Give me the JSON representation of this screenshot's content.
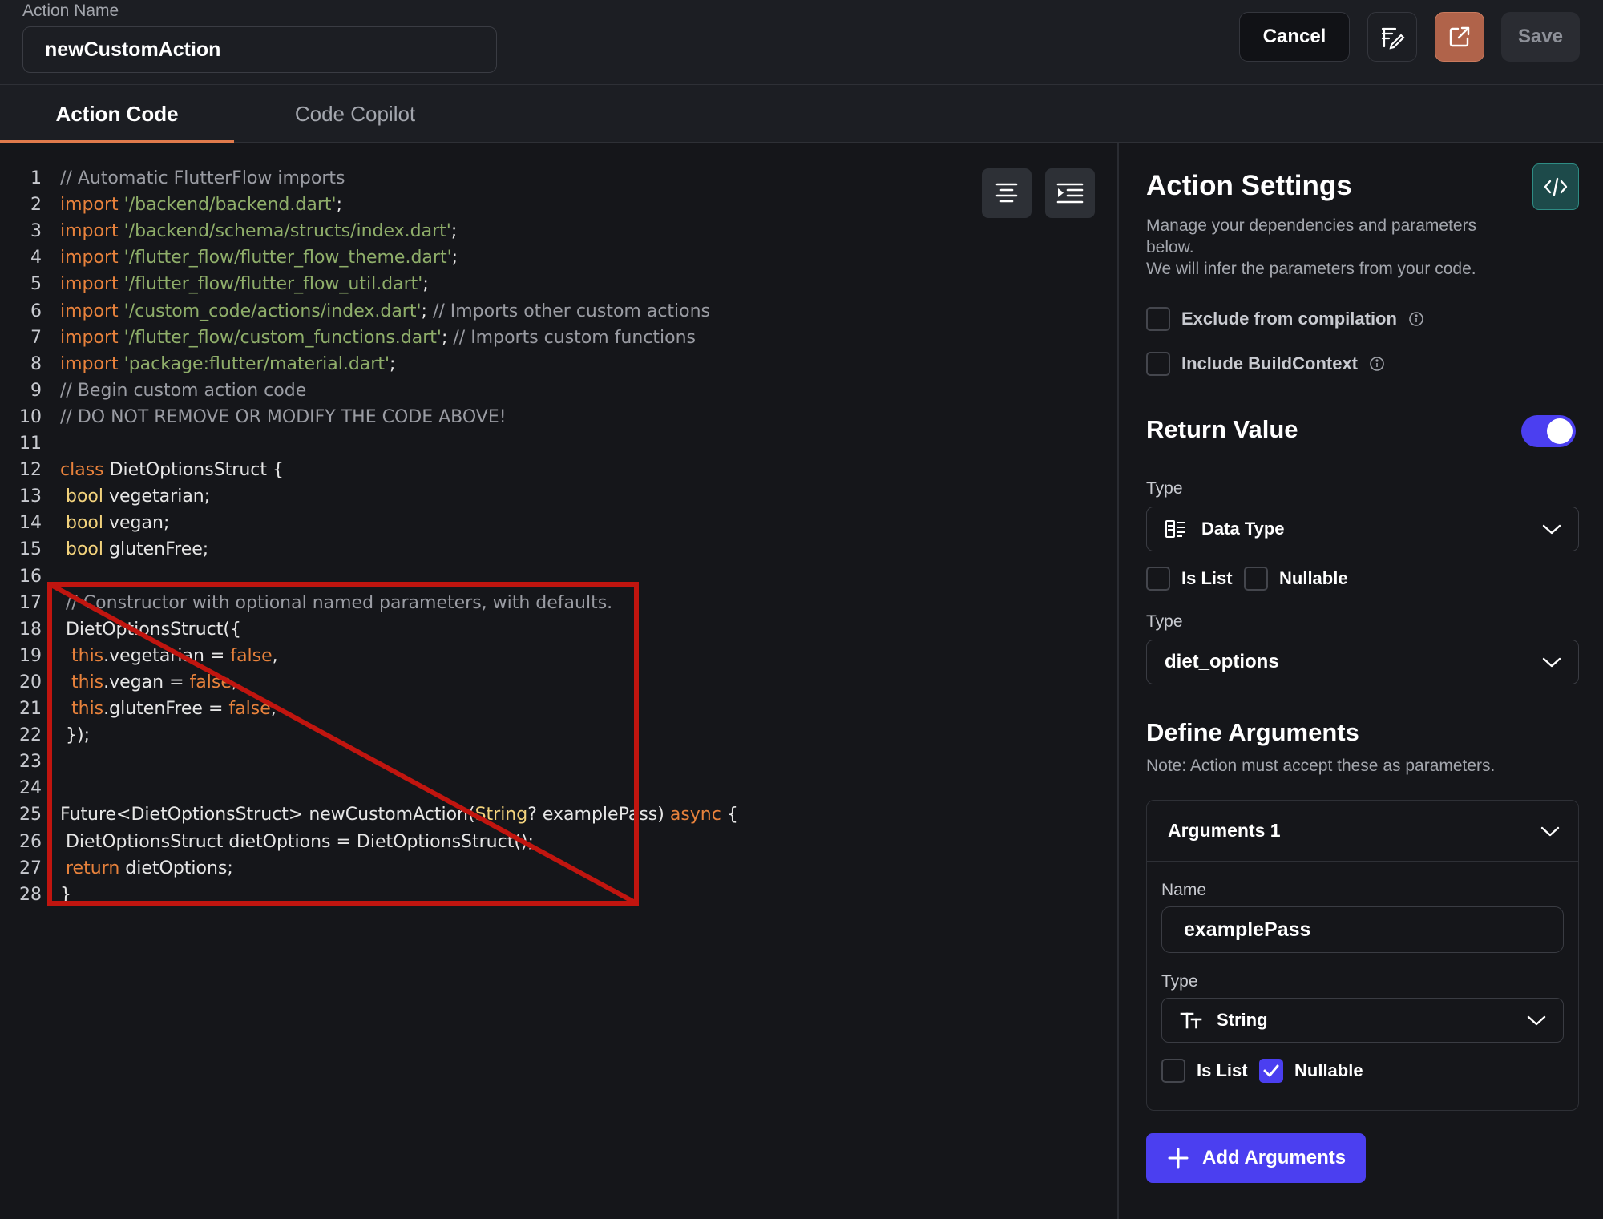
{
  "header": {
    "action_name_label": "Action Name",
    "action_name_value": "newCustomAction",
    "cancel_label": "Cancel",
    "save_label": "Save"
  },
  "tabs": [
    {
      "label": "Action Code",
      "active": true
    },
    {
      "label": "Code Copilot",
      "active": false
    }
  ],
  "code_lines": [
    {
      "n": "1",
      "tokens": [
        {
          "t": "// Automatic FlutterFlow imports",
          "c": "comment"
        }
      ]
    },
    {
      "n": "2",
      "tokens": [
        {
          "t": "import ",
          "c": "kw"
        },
        {
          "t": "'/backend/backend.dart'",
          "c": "str"
        },
        {
          "t": ";",
          "c": "plain"
        }
      ]
    },
    {
      "n": "3",
      "tokens": [
        {
          "t": "import ",
          "c": "kw"
        },
        {
          "t": "'/backend/schema/structs/index.dart'",
          "c": "str"
        },
        {
          "t": ";",
          "c": "plain"
        }
      ]
    },
    {
      "n": "4",
      "tokens": [
        {
          "t": "import ",
          "c": "kw"
        },
        {
          "t": "'/flutter_flow/flutter_flow_theme.dart'",
          "c": "str"
        },
        {
          "t": ";",
          "c": "plain"
        }
      ]
    },
    {
      "n": "5",
      "tokens": [
        {
          "t": "import ",
          "c": "kw"
        },
        {
          "t": "'/flutter_flow/flutter_flow_util.dart'",
          "c": "str"
        },
        {
          "t": ";",
          "c": "plain"
        }
      ]
    },
    {
      "n": "6",
      "tokens": [
        {
          "t": "import ",
          "c": "kw"
        },
        {
          "t": "'/custom_code/actions/index.dart'",
          "c": "str"
        },
        {
          "t": "; ",
          "c": "plain"
        },
        {
          "t": "// Imports other custom actions",
          "c": "comment"
        }
      ]
    },
    {
      "n": "7",
      "tokens": [
        {
          "t": "import ",
          "c": "kw"
        },
        {
          "t": "'/flutter_flow/custom_functions.dart'",
          "c": "str"
        },
        {
          "t": "; ",
          "c": "plain"
        },
        {
          "t": "// Imports custom functions",
          "c": "comment"
        }
      ]
    },
    {
      "n": "8",
      "tokens": [
        {
          "t": "import ",
          "c": "kw"
        },
        {
          "t": "'package:flutter/material.dart'",
          "c": "str"
        },
        {
          "t": ";",
          "c": "plain"
        }
      ]
    },
    {
      "n": "9",
      "tokens": [
        {
          "t": "// Begin custom action code",
          "c": "comment"
        }
      ]
    },
    {
      "n": "10",
      "tokens": [
        {
          "t": "// DO NOT REMOVE OR MODIFY THE CODE ABOVE!",
          "c": "comment"
        }
      ]
    },
    {
      "n": "11",
      "tokens": []
    },
    {
      "n": "12",
      "tokens": [
        {
          "t": "class ",
          "c": "kw"
        },
        {
          "t": "DietOptionsStruct {",
          "c": "plain"
        }
      ]
    },
    {
      "n": "13",
      "tokens": [
        {
          "t": " ",
          "c": "plain"
        },
        {
          "t": "bool",
          "c": "type"
        },
        {
          "t": " vegetarian;",
          "c": "plain"
        }
      ]
    },
    {
      "n": "14",
      "tokens": [
        {
          "t": " ",
          "c": "plain"
        },
        {
          "t": "bool",
          "c": "type"
        },
        {
          "t": " vegan;",
          "c": "plain"
        }
      ]
    },
    {
      "n": "15",
      "tokens": [
        {
          "t": " ",
          "c": "plain"
        },
        {
          "t": "bool",
          "c": "type"
        },
        {
          "t": " glutenFree;",
          "c": "plain"
        }
      ]
    },
    {
      "n": "16",
      "tokens": []
    },
    {
      "n": "17",
      "tokens": [
        {
          "t": " ",
          "c": "plain"
        },
        {
          "t": "// Constructor with optional named parameters, with defaults.",
          "c": "comment"
        }
      ]
    },
    {
      "n": "18",
      "tokens": [
        {
          "t": " DietOptionsStruct({",
          "c": "plain"
        }
      ]
    },
    {
      "n": "19",
      "tokens": [
        {
          "t": "  ",
          "c": "plain"
        },
        {
          "t": "this",
          "c": "kw"
        },
        {
          "t": ".vegetarian = ",
          "c": "plain"
        },
        {
          "t": "false",
          "c": "kw"
        },
        {
          "t": ",",
          "c": "plain"
        }
      ]
    },
    {
      "n": "20",
      "tokens": [
        {
          "t": "  ",
          "c": "plain"
        },
        {
          "t": "this",
          "c": "kw"
        },
        {
          "t": ".vegan = ",
          "c": "plain"
        },
        {
          "t": "false",
          "c": "kw"
        },
        {
          "t": ",",
          "c": "plain"
        }
      ]
    },
    {
      "n": "21",
      "tokens": [
        {
          "t": "  ",
          "c": "plain"
        },
        {
          "t": "this",
          "c": "kw"
        },
        {
          "t": ".glutenFree = ",
          "c": "plain"
        },
        {
          "t": "false",
          "c": "kw"
        },
        {
          "t": ",",
          "c": "plain"
        }
      ]
    },
    {
      "n": "22",
      "tokens": [
        {
          "t": " });",
          "c": "plain"
        }
      ]
    },
    {
      "n": "23",
      "tokens": []
    },
    {
      "n": "24",
      "tokens": []
    },
    {
      "n": "25",
      "tokens": [
        {
          "t": "Future<DietOptionsStruct> newCustomAction(",
          "c": "plain"
        },
        {
          "t": "String",
          "c": "type"
        },
        {
          "t": "? examplePass) ",
          "c": "plain"
        },
        {
          "t": "async",
          "c": "kw"
        },
        {
          "t": " {",
          "c": "plain"
        }
      ]
    },
    {
      "n": "26",
      "tokens": [
        {
          "t": " DietOptionsStruct dietOptions = DietOptionsStruct();",
          "c": "plain"
        }
      ]
    },
    {
      "n": "27",
      "tokens": [
        {
          "t": " ",
          "c": "plain"
        },
        {
          "t": "return",
          "c": "kw"
        },
        {
          "t": " dietOptions;",
          "c": "plain"
        }
      ]
    },
    {
      "n": "28",
      "tokens": [
        {
          "t": "}",
          "c": "plain"
        }
      ]
    }
  ],
  "settings": {
    "title": "Action Settings",
    "description": "Manage your dependencies and parameters below.\nWe will infer the parameters from your code.",
    "exclude_label": "Exclude from compilation",
    "exclude_checked": false,
    "buildcontext_label": "Include BuildContext",
    "buildcontext_checked": false
  },
  "return_value": {
    "title": "Return Value",
    "enabled": true,
    "type_label": "Type",
    "type_value": "Data Type",
    "is_list_label": "Is List",
    "is_list_checked": false,
    "nullable_label": "Nullable",
    "nullable_checked": false,
    "subtype_label": "Type",
    "subtype_value": "diet_options"
  },
  "arguments": {
    "title": "Define Arguments",
    "note": "Note: Action must accept these as parameters.",
    "items": [
      {
        "header": "Arguments 1",
        "name_label": "Name",
        "name_value": "examplePass",
        "type_label": "Type",
        "type_value": "String",
        "is_list_label": "Is List",
        "is_list_checked": false,
        "nullable_label": "Nullable",
        "nullable_checked": true
      }
    ],
    "add_label": "Add Arguments"
  },
  "colors": {
    "accent": "#4b3ff0",
    "tab_underline": "#e07a4c",
    "annotation": "#c0150f",
    "keyword": "#e8823c",
    "string": "#8fae6a",
    "type": "#f2d27c",
    "comment": "#9a9ca3"
  }
}
